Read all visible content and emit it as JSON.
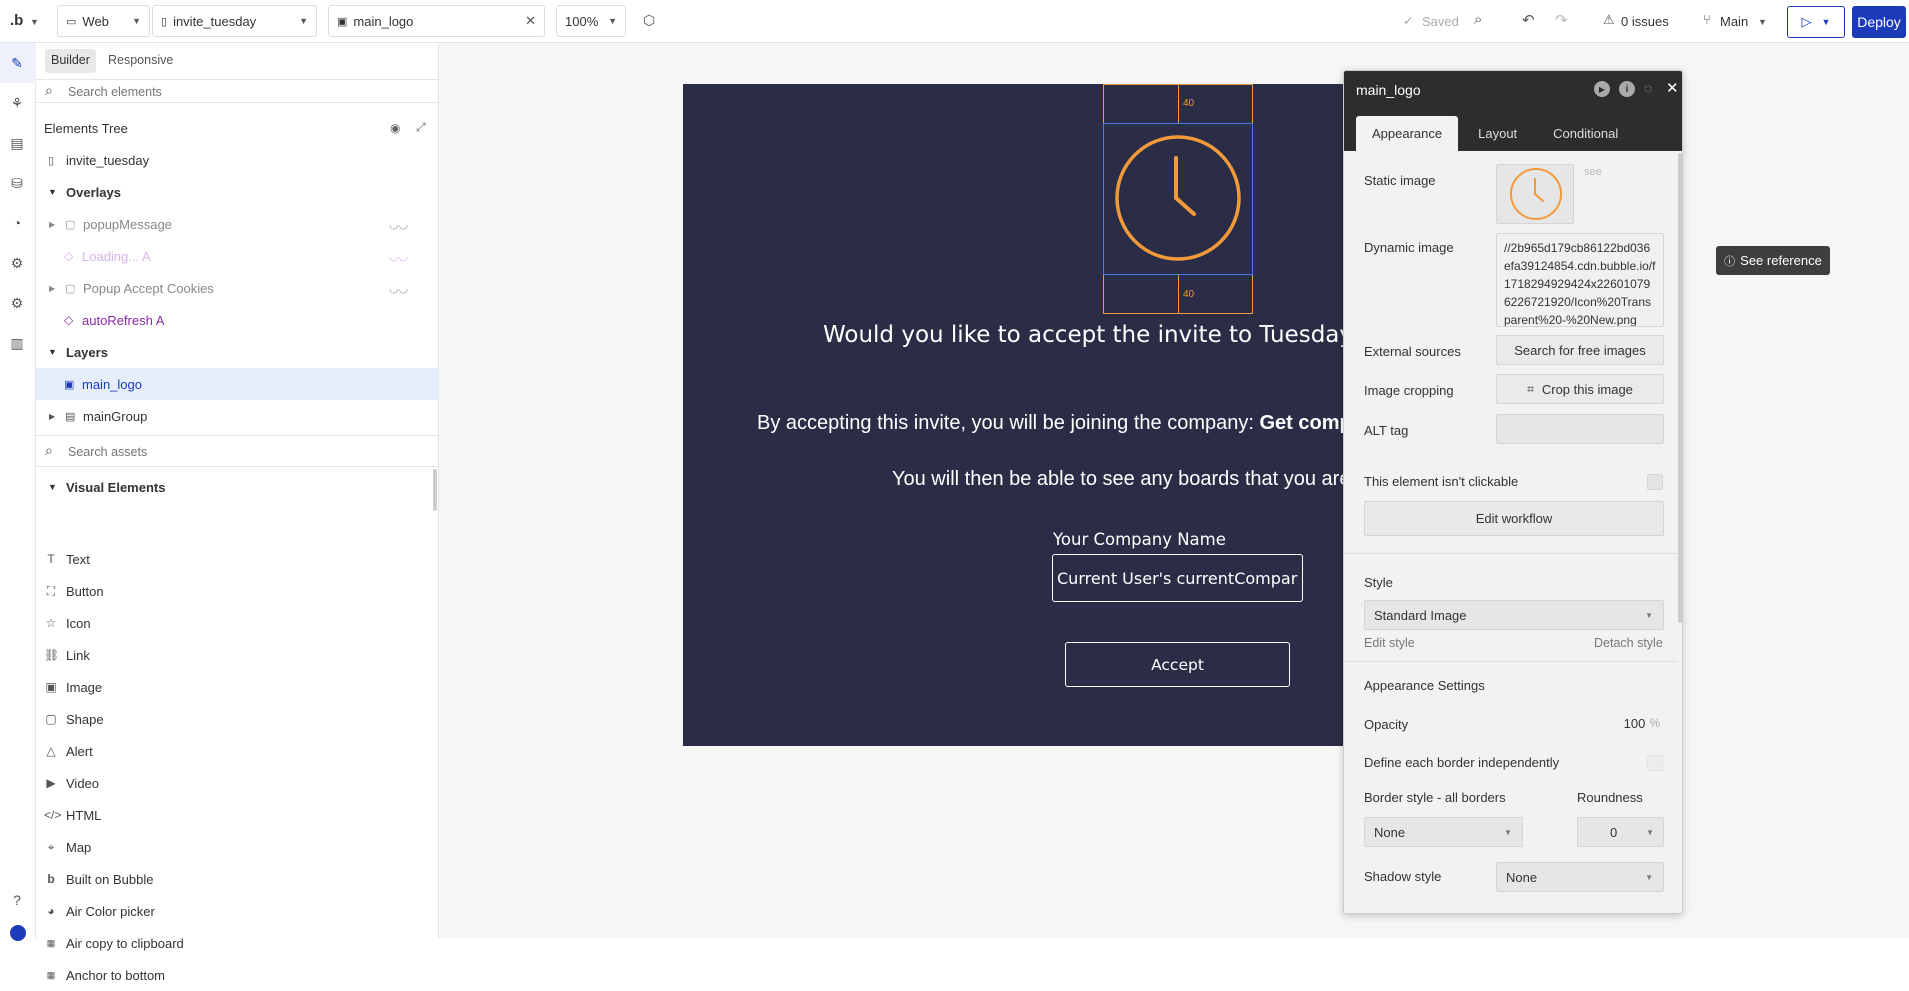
{
  "topbar": {
    "logo": ".b",
    "platform": "Web",
    "page": "invite_tuesday",
    "element": "main_logo",
    "zoom": "100%",
    "saved": "Saved",
    "issues": "0 issues",
    "branch": "Main",
    "deploy": "Deploy"
  },
  "panel": {
    "tab_builder": "Builder",
    "tab_responsive": "Responsive",
    "search_elements_placeholder": "Search elements",
    "tree_title": "Elements Tree",
    "tree": {
      "page": "invite_tuesday",
      "overlays": "Overlays",
      "popup_message": "popupMessage",
      "loading": "Loading... A",
      "popup_cookies": "Popup Accept Cookies",
      "auto_refresh": "autoRefresh A",
      "layers": "Layers",
      "main_logo": "main_logo",
      "main_group": "mainGroup"
    },
    "search_assets_placeholder": "Search assets",
    "visual_elements": "Visual Elements",
    "elements": [
      "Text",
      "Button",
      "Icon",
      "Link",
      "Image",
      "Shape",
      "Alert",
      "Video",
      "HTML",
      "Map",
      "Built on Bubble",
      "Air Color picker",
      "Air copy to clipboard",
      "Anchor to bottom"
    ]
  },
  "canvas": {
    "margin_top": "40",
    "margin_bottom": "40",
    "heading": "Would you like to accept the invite to Tuesday by",
    "line1_prefix": "By accepting this invite, you will be joining the company: ",
    "line1_bold": "Get comp",
    "line2": "You will then be able to see any boards that you are",
    "company_label": "Your Company Name",
    "company_input": "Current User's currentCompar",
    "accept": "Accept",
    "see_reference": "See reference"
  },
  "props": {
    "title": "main_logo",
    "tabs": [
      "Appearance",
      "Layout",
      "Conditional"
    ],
    "static_image": "Static image",
    "see": "see",
    "dynamic_image": "Dynamic image",
    "dynamic_image_value": "//2b965d179cb86122bd036efa39124854.cdn.bubble.io/f1718294929424x226010796226721920/Icon%20Transparent%20-%20New.png",
    "external_sources": "External sources",
    "search_free_images": "Search for free images",
    "image_cropping": "Image cropping",
    "crop_image": "Crop this image",
    "alt_tag": "ALT tag",
    "not_clickable": "This element isn't clickable",
    "edit_workflow": "Edit workflow",
    "style": "Style",
    "style_value": "Standard Image",
    "edit_style": "Edit style",
    "detach_style": "Detach style",
    "appearance_settings": "Appearance Settings",
    "opacity": "Opacity",
    "opacity_value": "100",
    "opacity_unit": "%",
    "define_border": "Define each border independently",
    "border_style": "Border style - all borders",
    "roundness": "Roundness",
    "border_value": "None",
    "roundness_value": "0",
    "shadow_style": "Shadow style",
    "shadow_value": "None"
  },
  "colors": {
    "accent": "#1b3bb8",
    "canvas_bg": "#2b2d47",
    "logo_orange": "#f29a3a",
    "purple": "#8a2aa8"
  }
}
